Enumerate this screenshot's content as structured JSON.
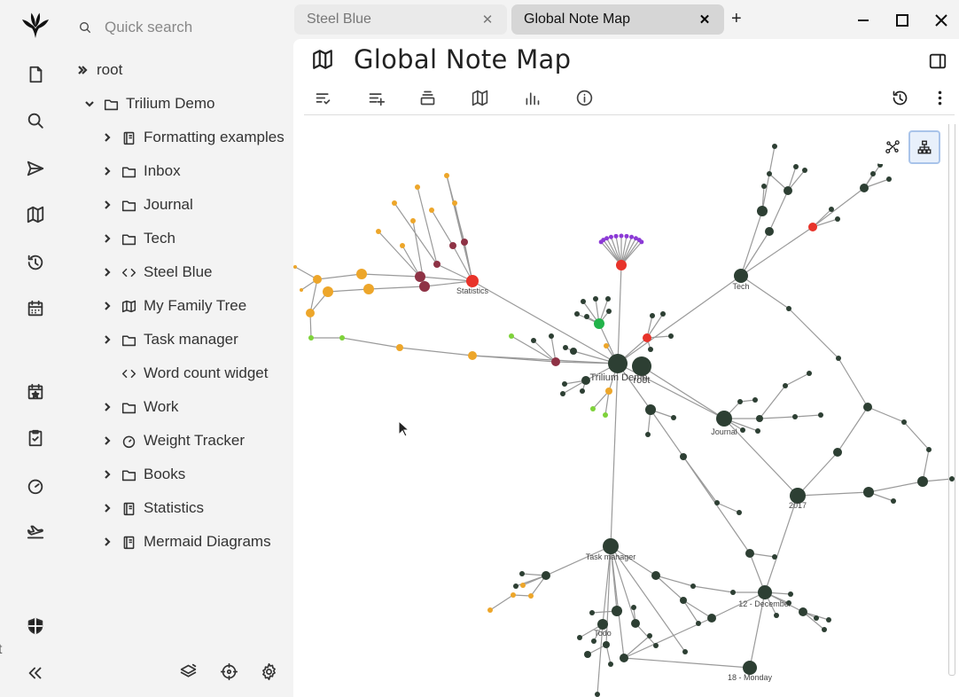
{
  "search": {
    "placeholder": "Quick search"
  },
  "launcher": {
    "items": [
      "new-note-icon",
      "search-icon",
      "send-icon",
      "map-icon",
      "history-icon",
      "calendar-icon",
      "starred-calendar-icon",
      "task-icon",
      "gauge-icon",
      "plane-icon",
      "shield-icon",
      "collapse-icon"
    ],
    "stray_text": "t"
  },
  "tree": {
    "root_label": "root",
    "items": [
      {
        "label": "Trilium Demo",
        "icon": "folder",
        "expanded": true
      },
      {
        "label": "Formatting examples",
        "icon": "book"
      },
      {
        "label": "Inbox",
        "icon": "folder"
      },
      {
        "label": "Journal",
        "icon": "folder"
      },
      {
        "label": "Tech",
        "icon": "folder"
      },
      {
        "label": "Steel Blue",
        "icon": "code"
      },
      {
        "label": "My Family Tree",
        "icon": "map"
      },
      {
        "label": "Task manager",
        "icon": "folder"
      },
      {
        "label": "Word count widget",
        "icon": "code"
      },
      {
        "label": "Work",
        "icon": "folder"
      },
      {
        "label": "Weight Tracker",
        "icon": "gauge"
      },
      {
        "label": "Books",
        "icon": "folder"
      },
      {
        "label": "Statistics",
        "icon": "book"
      },
      {
        "label": "Mermaid Diagrams",
        "icon": "book"
      }
    ]
  },
  "tabs": [
    {
      "title": "Steel Blue",
      "active": false
    },
    {
      "title": "Global Note Map",
      "active": true
    }
  ],
  "note": {
    "title": "Global Note Map"
  },
  "graph_labels": {
    "statistics": "Statistics",
    "tech": "Tech",
    "trilium_demo": "Trilium Demo",
    "root": "root",
    "journal": "Journal",
    "y2017": "2017",
    "task_manager": "Task manager",
    "december": "12 - December",
    "monday": "18 - Monday",
    "todo": "Todo"
  },
  "colors": {
    "node_dark": "#2d3f33",
    "node_red": "#e8332a",
    "node_orange": "#eda62a",
    "node_maroon": "#8e3245",
    "node_green": "#22b34a",
    "node_lightgreen": "#7ed23a",
    "node_purple": "#8c3ad6",
    "link": "#9a9a9a",
    "accent_selected": "#a9c4ea"
  }
}
